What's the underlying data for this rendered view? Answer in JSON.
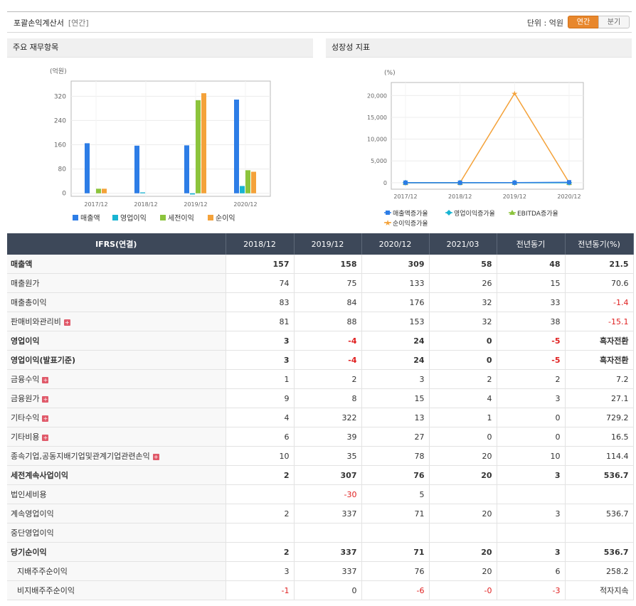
{
  "header": {
    "title": "포괄손익계산서",
    "period_tag": "[연간]",
    "unit_label": "단위 : 억원",
    "toggle_annual": "연간",
    "toggle_quarter": "분기"
  },
  "panels": {
    "left_title": "주요 재무항목",
    "right_title": "성장성 지표"
  },
  "chart_data": [
    {
      "type": "bar",
      "title": "주요 재무항목",
      "ylabel": "(억원)",
      "categories": [
        "2017/12",
        "2018/12",
        "2019/12",
        "2020/12"
      ],
      "yticks": [
        0,
        80,
        160,
        240,
        320
      ],
      "ylim": [
        -10,
        370
      ],
      "grid": true,
      "legend": "bottom",
      "series": [
        {
          "name": "매출액",
          "color": "#2d7de6",
          "values": [
            165,
            157,
            158,
            309
          ]
        },
        {
          "name": "영업이익",
          "color": "#18b4d2",
          "values": [
            0,
            3,
            -4,
            24
          ]
        },
        {
          "name": "세전이익",
          "color": "#8cc43c",
          "values": [
            15,
            0,
            307,
            76
          ]
        },
        {
          "name": "순이익",
          "color": "#f4a23a",
          "values": [
            15,
            0,
            330,
            71
          ]
        }
      ]
    },
    {
      "type": "line",
      "title": "성장성 지표",
      "ylabel": "(%)",
      "categories": [
        "2017/12",
        "2018/12",
        "2019/12",
        "2020/12"
      ],
      "yticks": [
        0,
        5000,
        10000,
        15000,
        20000
      ],
      "ytick_labels": [
        "0",
        "5,000",
        "10,000",
        "15,000",
        "20,000"
      ],
      "ylim": [
        -1500,
        23000
      ],
      "grid": true,
      "legend": "bottom",
      "series": [
        {
          "name": "매출액증가율",
          "color": "#2d7de6",
          "marker": "square",
          "values": [
            0,
            -5,
            1,
            96
          ]
        },
        {
          "name": "영업이익증가율",
          "color": "#18b4d2",
          "marker": "diamond",
          "values": [
            0,
            0,
            0,
            0
          ]
        },
        {
          "name": "EBITDA증가율",
          "color": "#8cc43c",
          "marker": "triangle",
          "values": [
            0,
            0,
            0,
            0
          ]
        },
        {
          "name": "순이익증가율",
          "color": "#f4a23a",
          "marker": "star",
          "values": [
            0,
            0,
            20500,
            0
          ]
        }
      ]
    }
  ],
  "table": {
    "columns": [
      "IFRS(연결)",
      "2018/12",
      "2019/12",
      "2020/12",
      "2021/03",
      "전년동기",
      "전년동기(%)"
    ],
    "rows": [
      {
        "label": "매출액",
        "bold": true,
        "plus": false,
        "sub": false,
        "cells": [
          "157",
          "158",
          "309",
          "58",
          "48",
          "21.5"
        ]
      },
      {
        "label": "매출원가",
        "bold": false,
        "plus": false,
        "sub": false,
        "cells": [
          "74",
          "75",
          "133",
          "26",
          "15",
          "70.6"
        ]
      },
      {
        "label": "매출총이익",
        "bold": false,
        "plus": false,
        "sub": false,
        "cells": [
          "83",
          "84",
          "176",
          "32",
          "33",
          "-1.4"
        ]
      },
      {
        "label": "판매비와관리비",
        "bold": false,
        "plus": true,
        "sub": false,
        "cells": [
          "81",
          "88",
          "153",
          "32",
          "38",
          "-15.1"
        ]
      },
      {
        "label": "영업이익",
        "bold": true,
        "plus": false,
        "sub": false,
        "cells": [
          "3",
          "-4",
          "24",
          "0",
          "-5",
          "흑자전환"
        ]
      },
      {
        "label": "영업이익(발표기준)",
        "bold": true,
        "plus": false,
        "sub": false,
        "cells": [
          "3",
          "-4",
          "24",
          "0",
          "-5",
          "흑자전환"
        ]
      },
      {
        "label": "금융수익",
        "bold": false,
        "plus": true,
        "sub": false,
        "cells": [
          "1",
          "2",
          "3",
          "2",
          "2",
          "7.2"
        ]
      },
      {
        "label": "금융원가",
        "bold": false,
        "plus": true,
        "sub": false,
        "cells": [
          "9",
          "8",
          "15",
          "4",
          "3",
          "27.1"
        ]
      },
      {
        "label": "기타수익",
        "bold": false,
        "plus": true,
        "sub": false,
        "cells": [
          "4",
          "322",
          "13",
          "1",
          "0",
          "729.2"
        ]
      },
      {
        "label": "기타비용",
        "bold": false,
        "plus": true,
        "sub": false,
        "cells": [
          "6",
          "39",
          "27",
          "0",
          "0",
          "16.5"
        ]
      },
      {
        "label": "종속기업,공동지배기업및관계기업관련손익",
        "bold": false,
        "plus": true,
        "sub": false,
        "cells": [
          "10",
          "35",
          "78",
          "20",
          "10",
          "114.4"
        ]
      },
      {
        "label": "세전계속사업이익",
        "bold": true,
        "plus": false,
        "sub": false,
        "cells": [
          "2",
          "307",
          "76",
          "20",
          "3",
          "536.7"
        ]
      },
      {
        "label": "법인세비용",
        "bold": false,
        "plus": false,
        "sub": false,
        "cells": [
          "",
          "-30",
          "5",
          "",
          "",
          ""
        ]
      },
      {
        "label": "계속영업이익",
        "bold": false,
        "plus": false,
        "sub": false,
        "cells": [
          "2",
          "337",
          "71",
          "20",
          "3",
          "536.7"
        ]
      },
      {
        "label": "중단영업이익",
        "bold": false,
        "plus": false,
        "sub": false,
        "cells": [
          "",
          "",
          "",
          "",
          "",
          ""
        ]
      },
      {
        "label": "당기순이익",
        "bold": true,
        "plus": false,
        "sub": false,
        "cells": [
          "2",
          "337",
          "71",
          "20",
          "3",
          "536.7"
        ]
      },
      {
        "label": "지배주주순이익",
        "bold": false,
        "plus": false,
        "sub": true,
        "cells": [
          "3",
          "337",
          "76",
          "20",
          "6",
          "258.2"
        ]
      },
      {
        "label": "비지배주주순이익",
        "bold": false,
        "plus": false,
        "sub": true,
        "cells": [
          "-1",
          "0",
          "-6",
          "-0",
          "-3",
          "적자지속"
        ]
      }
    ]
  },
  "icons": {
    "expand": "plus-icon"
  }
}
